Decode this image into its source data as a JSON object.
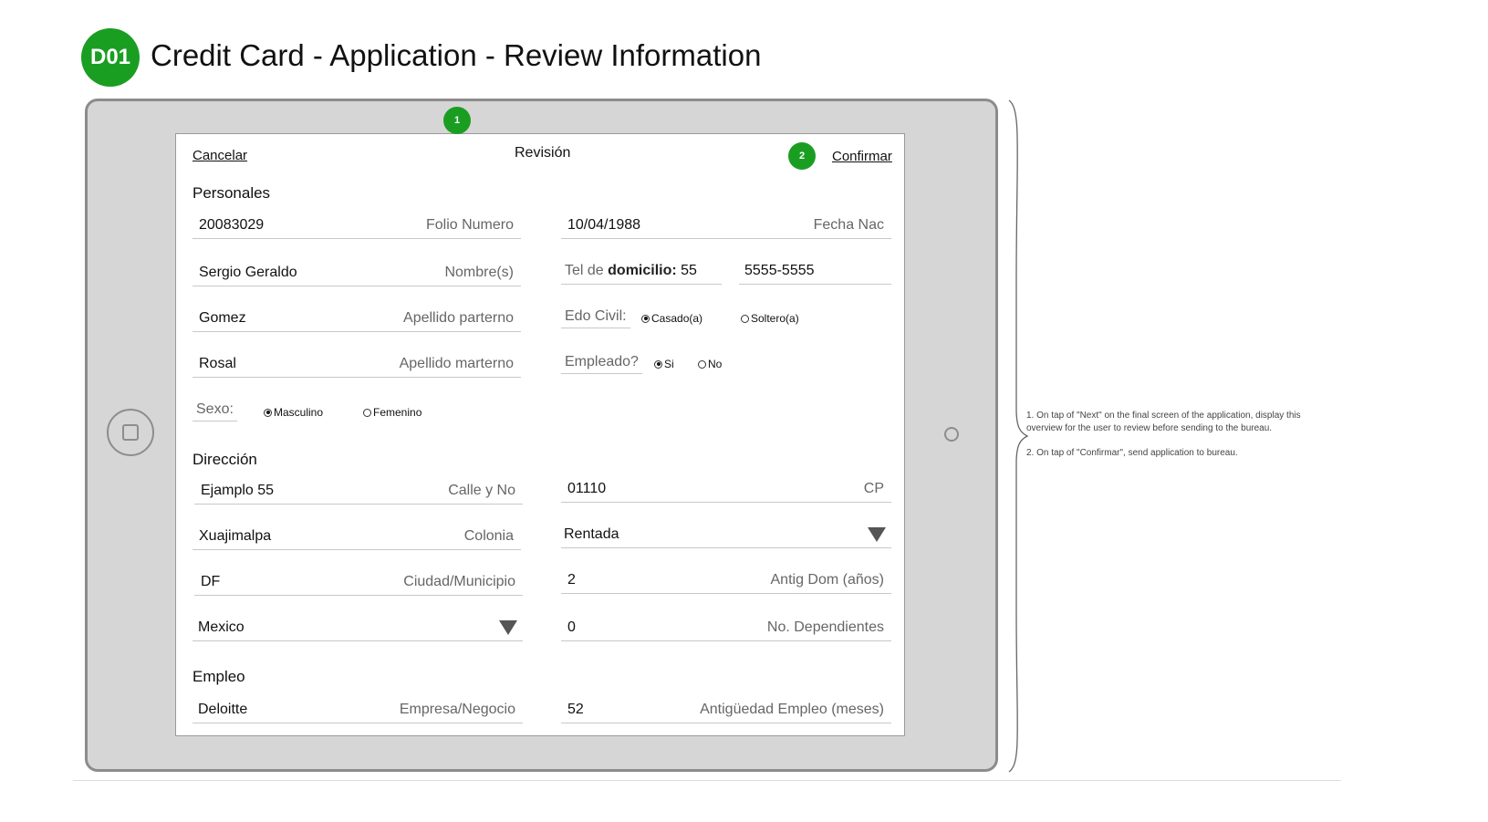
{
  "header": {
    "badge": "D01",
    "title": "Credit Card - Application - Review Information"
  },
  "markers": {
    "m1": "1",
    "m2": "2"
  },
  "nav": {
    "cancel": "Cancelar",
    "title": "Revisión",
    "confirm": "Confirmar"
  },
  "sections": {
    "personal": "Personales",
    "address": "Dirección",
    "employment": "Empleo"
  },
  "personal": {
    "folio": {
      "value": "20083029",
      "label": "Folio Numero"
    },
    "dob": {
      "value": "10/04/1988",
      "label": "Fecha Nac"
    },
    "name": {
      "value": "Sergio Geraldo",
      "label": "Nombre(s)"
    },
    "phone": {
      "label_prefix": "Tel de ",
      "label_bold": "domicilio:",
      "area": "55",
      "number": "5555-5555"
    },
    "surname1": {
      "value": "Gomez",
      "label": "Apellido parterno"
    },
    "marital": {
      "label": "Edo Civil:",
      "opt1": "Casado(a)",
      "opt2": "Soltero(a)",
      "selected": "Casado(a)"
    },
    "surname2": {
      "value": "Rosal",
      "label": "Apellido marterno"
    },
    "employed": {
      "label": "Empleado?",
      "opt1": "Si",
      "opt2": "No",
      "selected": "Si"
    },
    "sex": {
      "label": "Sexo:",
      "opt1": "Masculino",
      "opt2": "Femenino",
      "selected": "Masculino"
    }
  },
  "address": {
    "street": {
      "value": "Ejamplo 55",
      "label": "Calle y No"
    },
    "cp": {
      "value": "01110",
      "label": "CP"
    },
    "colonia": {
      "value": "Xuajimalpa",
      "label": "Colonia"
    },
    "housing": {
      "value": "Rentada"
    },
    "city": {
      "value": "DF",
      "label": "Ciudad/Municipio"
    },
    "years": {
      "value": "2",
      "label": "Antig Dom (años)"
    },
    "country": {
      "value": "Mexico"
    },
    "dependents": {
      "value": "0",
      "label": "No. Dependientes"
    }
  },
  "employment": {
    "company": {
      "value": "Deloitte",
      "label": "Empresa/Negocio"
    },
    "months": {
      "value": "52",
      "label": "Antigüedad Empleo (meses)"
    }
  },
  "notes": {
    "n1": "1. On tap of \"Next\" on the final screen of the application, display this overview for the user to review before sending to the bureau.",
    "n2": "2. On tap of \"Confirmar\", send application to bureau."
  },
  "colors": {
    "accent": "#1a9e22",
    "tablet": "#d6d6d6",
    "tablet_border": "#8c8c8c"
  }
}
